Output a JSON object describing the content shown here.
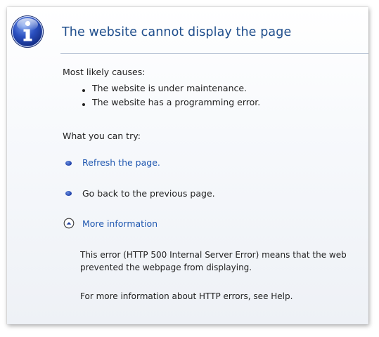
{
  "title": "The website cannot display the page",
  "causes": {
    "heading": "Most likely causes:",
    "items": [
      "The website is under maintenance.",
      "The website has a programming error."
    ]
  },
  "try": {
    "heading": "What you can try:",
    "refresh_label": "Refresh the page.",
    "back_label": "Go back to the previous page."
  },
  "more_info": {
    "label": "More information",
    "line1": "This error (HTTP 500 Internal Server Error) means that the web",
    "line2": "prevented the webpage from displaying.",
    "help_line": "For more information about HTTP errors, see Help."
  },
  "colors": {
    "title": "#1f4e8c",
    "link": "#1f57b0",
    "icon": "#1e3fa8"
  },
  "icons": {
    "header": "info-icon",
    "bullets": "blue-bullet-icon",
    "expand": "expand-up-icon"
  }
}
